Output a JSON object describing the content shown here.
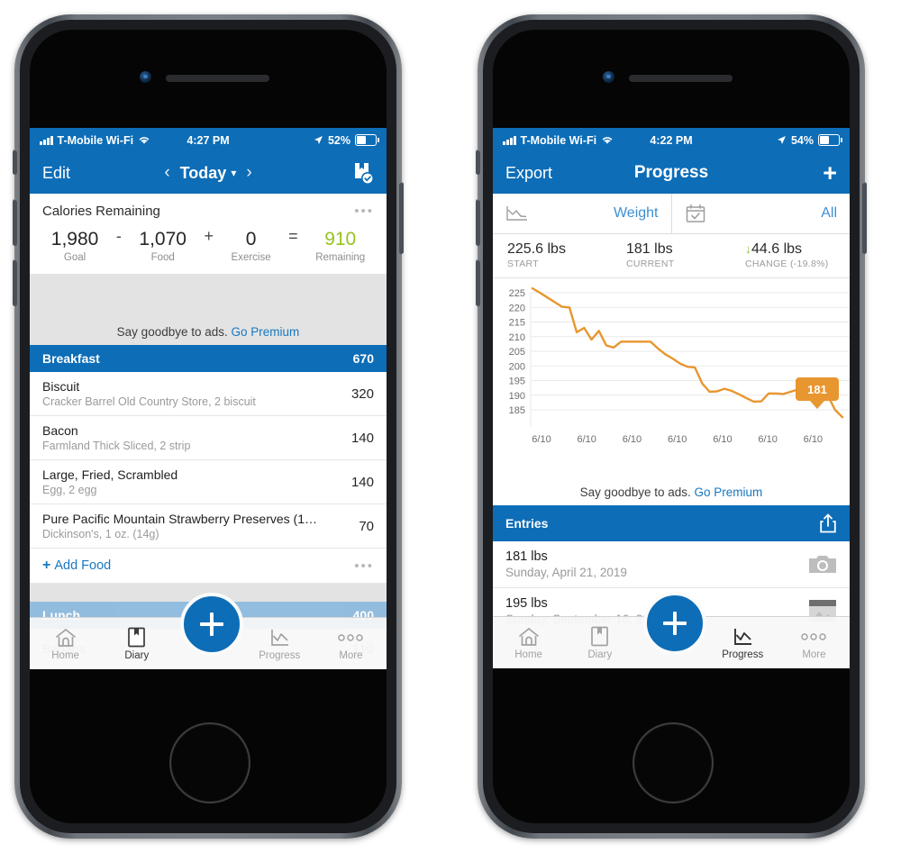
{
  "phones": {
    "left": {
      "status": {
        "carrier": "T-Mobile Wi-Fi",
        "time": "4:27 PM",
        "battery": "52%",
        "wifi_icon": "wifi-icon",
        "signal_icon": "signal-bars-icon",
        "location_icon": "location-arrow-icon",
        "battery_icon": "battery-icon"
      },
      "nav": {
        "left_label": "Edit",
        "title": "Today",
        "prev_icon": "chevron-left-icon",
        "next_icon": "chevron-right-icon",
        "caret_icon": "chevron-down-icon",
        "right_icon": "diary-check-icon"
      },
      "calories": {
        "title": "Calories Remaining",
        "more_icon": "more-dots-icon",
        "goal_value": "1,980",
        "goal_label": "Goal",
        "op1": "-",
        "food_value": "1,070",
        "food_label": "Food",
        "op2": "+",
        "exercise_value": "0",
        "exercise_label": "Exercise",
        "op3": "=",
        "remaining_value": "910",
        "remaining_label": "Remaining",
        "remaining_color": "#97c21f"
      },
      "ad": {
        "text": "Say goodbye to ads.",
        "link": "Go Premium"
      },
      "meal": {
        "name": "Breakfast",
        "total": "670"
      },
      "foods": [
        {
          "name": "Biscuit",
          "detail": "Cracker Barrel Old Country Store, 2 biscuit",
          "calories": "320"
        },
        {
          "name": "Bacon",
          "detail": "Farmland Thick Sliced, 2 strip",
          "calories": "140"
        },
        {
          "name": "Large, Fried, Scrambled",
          "detail": "Egg, 2 egg",
          "calories": "140"
        },
        {
          "name": "Pure Pacific Mountain Strawberry Preserves (1…",
          "detail": "Dickinson's, 1 oz. (14g)",
          "calories": "70"
        }
      ],
      "add_food": {
        "plus": "+",
        "label": "Add Food",
        "more_icon": "more-dots-icon"
      },
      "hidden_meal": {
        "name": "Lunch",
        "total": "400"
      },
      "hidden_food": {
        "name": "Banana",
        "calories": "110"
      },
      "tabs": [
        {
          "label": "Home",
          "icon": "home-icon",
          "active": false
        },
        {
          "label": "Diary",
          "icon": "diary-icon",
          "active": true
        },
        {
          "label": "Progress",
          "icon": "progress-chart-icon",
          "active": false
        },
        {
          "label": "More",
          "icon": "more-dots-icon",
          "active": false
        }
      ],
      "fab_icon": "plus-icon"
    },
    "right": {
      "status": {
        "carrier": "T-Mobile Wi-Fi",
        "time": "4:22 PM",
        "battery": "54%"
      },
      "nav": {
        "left_label": "Export",
        "title": "Progress",
        "right_label": "+",
        "right_icon": "plus-icon"
      },
      "filters": [
        {
          "icon": "line-chart-icon",
          "value": "Weight"
        },
        {
          "icon": "calendar-check-icon",
          "value": "All"
        }
      ],
      "stats": [
        {
          "value": "225.6 lbs",
          "label": "START"
        },
        {
          "value": "181 lbs",
          "label": "CURRENT"
        },
        {
          "value": "44.6 lbs",
          "label": "CHANGE (-19.8%)",
          "arrow": "↓",
          "arrow_color": "#8dc63f"
        }
      ],
      "ad": {
        "text": "Say goodbye to ads.",
        "link": "Go Premium"
      },
      "entries_header": {
        "title": "Entries",
        "share_icon": "share-upload-icon"
      },
      "entries": [
        {
          "weight": "181 lbs",
          "date": "Sunday, April 21, 2019",
          "icon": "camera-icon"
        },
        {
          "weight": "195 lbs",
          "date": "Sunday, September 16, 2018",
          "icon": "photo-icon"
        }
      ],
      "tabs": [
        {
          "label": "Home",
          "icon": "home-icon",
          "active": false
        },
        {
          "label": "Diary",
          "icon": "diary-icon",
          "active": false
        },
        {
          "label": "Progress",
          "icon": "progress-chart-icon",
          "active": true
        },
        {
          "label": "More",
          "icon": "more-dots-icon",
          "active": false
        }
      ],
      "fab_icon": "plus-icon"
    }
  },
  "chart_data": {
    "type": "line",
    "title": "",
    "xlabel": "",
    "ylabel": "",
    "ylim": [
      183,
      227
    ],
    "yticks": [
      225,
      220,
      215,
      210,
      205,
      200,
      195,
      190,
      185
    ],
    "xticks": [
      "6/10",
      "6/10",
      "6/10",
      "6/10",
      "6/10",
      "6/10",
      "6/10"
    ],
    "grid": true,
    "legend": "none",
    "line_color": "#e8962f",
    "annotation": {
      "label": "181",
      "color": "#e8962f",
      "text_color": "#ffffff"
    },
    "series": [
      {
        "name": "Weight",
        "values": [
          226.5,
          225.0,
          223.4,
          221.8,
          220.2,
          220.0,
          211.5,
          213.0,
          209.0,
          212.0,
          207.0,
          206.3,
          208.3,
          208.3,
          208.3,
          208.3,
          208.3,
          206.0,
          204.0,
          202.5,
          200.8,
          199.7,
          199.5,
          194.0,
          191.2,
          191.3,
          192.2,
          191.5,
          190.3,
          189.0,
          187.8,
          187.9,
          190.6,
          190.6,
          190.4,
          191.2,
          192.0,
          193.0,
          194.0,
          195.2,
          190.0,
          185.0,
          182.5
        ]
      }
    ]
  }
}
